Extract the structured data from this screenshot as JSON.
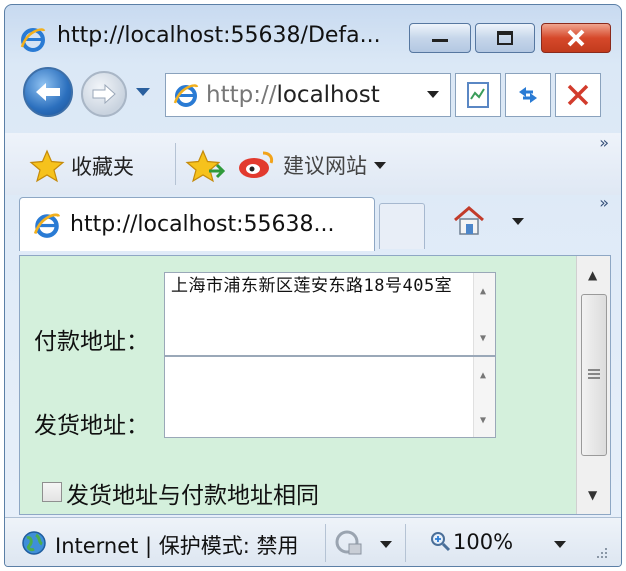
{
  "window": {
    "title": "http://localhost:55638/Defa..."
  },
  "navigation": {
    "address": "http://localhost",
    "address_dim": "http://",
    "address_host": "localhost"
  },
  "favorites_bar": {
    "favorites_label": "收藏夹",
    "suggested_sites_label": "建议网站",
    "overflow": "»"
  },
  "tabs": [
    {
      "label": "http://localhost:55638..."
    }
  ],
  "tab_overflow": "»",
  "form": {
    "billing_label": "付款地址：",
    "billing_value": "上海市浦东新区莲安东路18号405室",
    "shipping_label": "发货地址：",
    "shipping_value": "",
    "same_address_label": "发货地址与付款地址相同",
    "same_address_checked": false
  },
  "status_bar": {
    "zone_text": "Internet | 保护模式: 禁用",
    "zoom": "100%"
  },
  "colors": {
    "content_background": "#d4f0dc",
    "close_button": "#d6482a"
  }
}
